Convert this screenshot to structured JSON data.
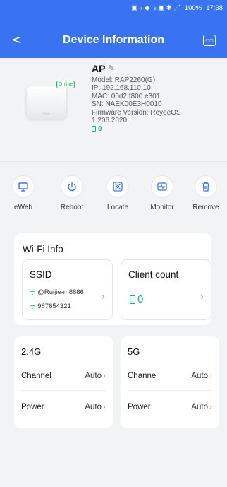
{
  "status_bar": {
    "left_icons": "▣ ᵢₗₗ ◆",
    "right_icons": "ᵢₗ ▣ ✱ ⋰",
    "battery": "100%",
    "time": "17:38"
  },
  "header": {
    "title": "Device Information",
    "back_icon": "chevron-left-icon",
    "right_icon": "qr-icon",
    "right_icon_text": "▢▢",
    "accent": "#3a73f1"
  },
  "device": {
    "brand_on_image": "Ruijie",
    "badge": "Online",
    "name": "AP",
    "model": "Model: RAP2260(G)",
    "ip": "IP:  192.168.110.10",
    "mac": "MAC:  00d2.f800.e301",
    "sn": "SN: NAEK00E3H0010",
    "firmware": "Firmware Version: ReyeeOS 1.206.2020",
    "client_count": "0"
  },
  "actions": [
    {
      "label": "eWeb",
      "icon": "monitor-icon"
    },
    {
      "label": "Reboot",
      "icon": "power-icon"
    },
    {
      "label": "Locate",
      "icon": "locate-icon"
    },
    {
      "label": "Monitor",
      "icon": "pulse-icon"
    },
    {
      "label": "Remove",
      "icon": "trash-icon"
    }
  ],
  "wifi_info": {
    "title": "Wi-Fi Info",
    "ssid_title": "SSID",
    "ssids": [
      "@Ruijie-m8886",
      "987654321"
    ],
    "client_title": "Client count",
    "client_value": "0"
  },
  "band_24": {
    "title": "2.4G",
    "channel_label": "Channel",
    "channel_value": "Auto",
    "power_label": "Power",
    "power_value": "Auto"
  },
  "band_5": {
    "title": "5G",
    "channel_label": "Channel",
    "channel_value": "Auto",
    "power_label": "Power",
    "power_value": "Auto"
  },
  "colors": {
    "online": "#23b06d",
    "background": "#f2f3f5"
  }
}
